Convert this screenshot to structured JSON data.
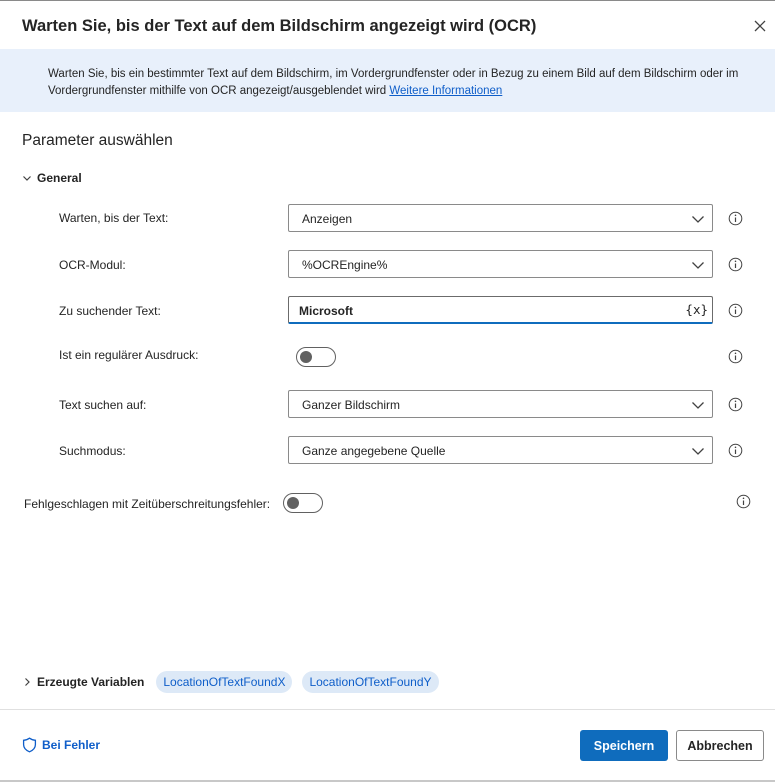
{
  "dialog": {
    "title": "Warten Sie, bis der Text auf dem Bildschirm angezeigt wird (OCR)",
    "close_icon": "close-icon"
  },
  "banner": {
    "text": "Warten Sie, bis ein bestimmter Text auf dem Bildschirm, im Vordergrundfenster oder in Bezug zu einem Bild auf dem Bildschirm oder im Vordergrundfenster mithilfe von OCR angezeigt/ausgeblendet wird",
    "link": "Weitere Informationen"
  },
  "section_title": "Parameter auswählen",
  "general": {
    "label": "General",
    "wait_until": {
      "label": "Warten, bis der Text:",
      "value": "Anzeigen"
    },
    "ocr_engine": {
      "label": "OCR-Modul:",
      "value": "%OCREngine%"
    },
    "search_text": {
      "label": "Zu suchender Text:",
      "value": "Microsoft",
      "var_button": "{x}"
    },
    "is_regex": {
      "label": "Ist ein regulärer Ausdruck:",
      "on": false
    },
    "search_on": {
      "label": "Text suchen auf:",
      "value": "Ganzer Bildschirm"
    },
    "search_mode": {
      "label": "Suchmodus:",
      "value": "Ganze angegebene Quelle"
    }
  },
  "timeout_error": {
    "label": "Fehlgeschlagen mit Zeitüberschreitungsfehler:",
    "on": false
  },
  "produced_variables": {
    "label": "Erzeugte Variablen",
    "items": [
      "LocationOfTextFoundX",
      "LocationOfTextFoundY"
    ]
  },
  "footer": {
    "on_error": "Bei Fehler",
    "save": "Speichern",
    "cancel": "Abbrechen"
  },
  "colors": {
    "accent": "#0f6cbd",
    "banner_bg": "#e8f0fb",
    "link": "#0f5ec9",
    "pill_bg": "#dde9f7"
  }
}
